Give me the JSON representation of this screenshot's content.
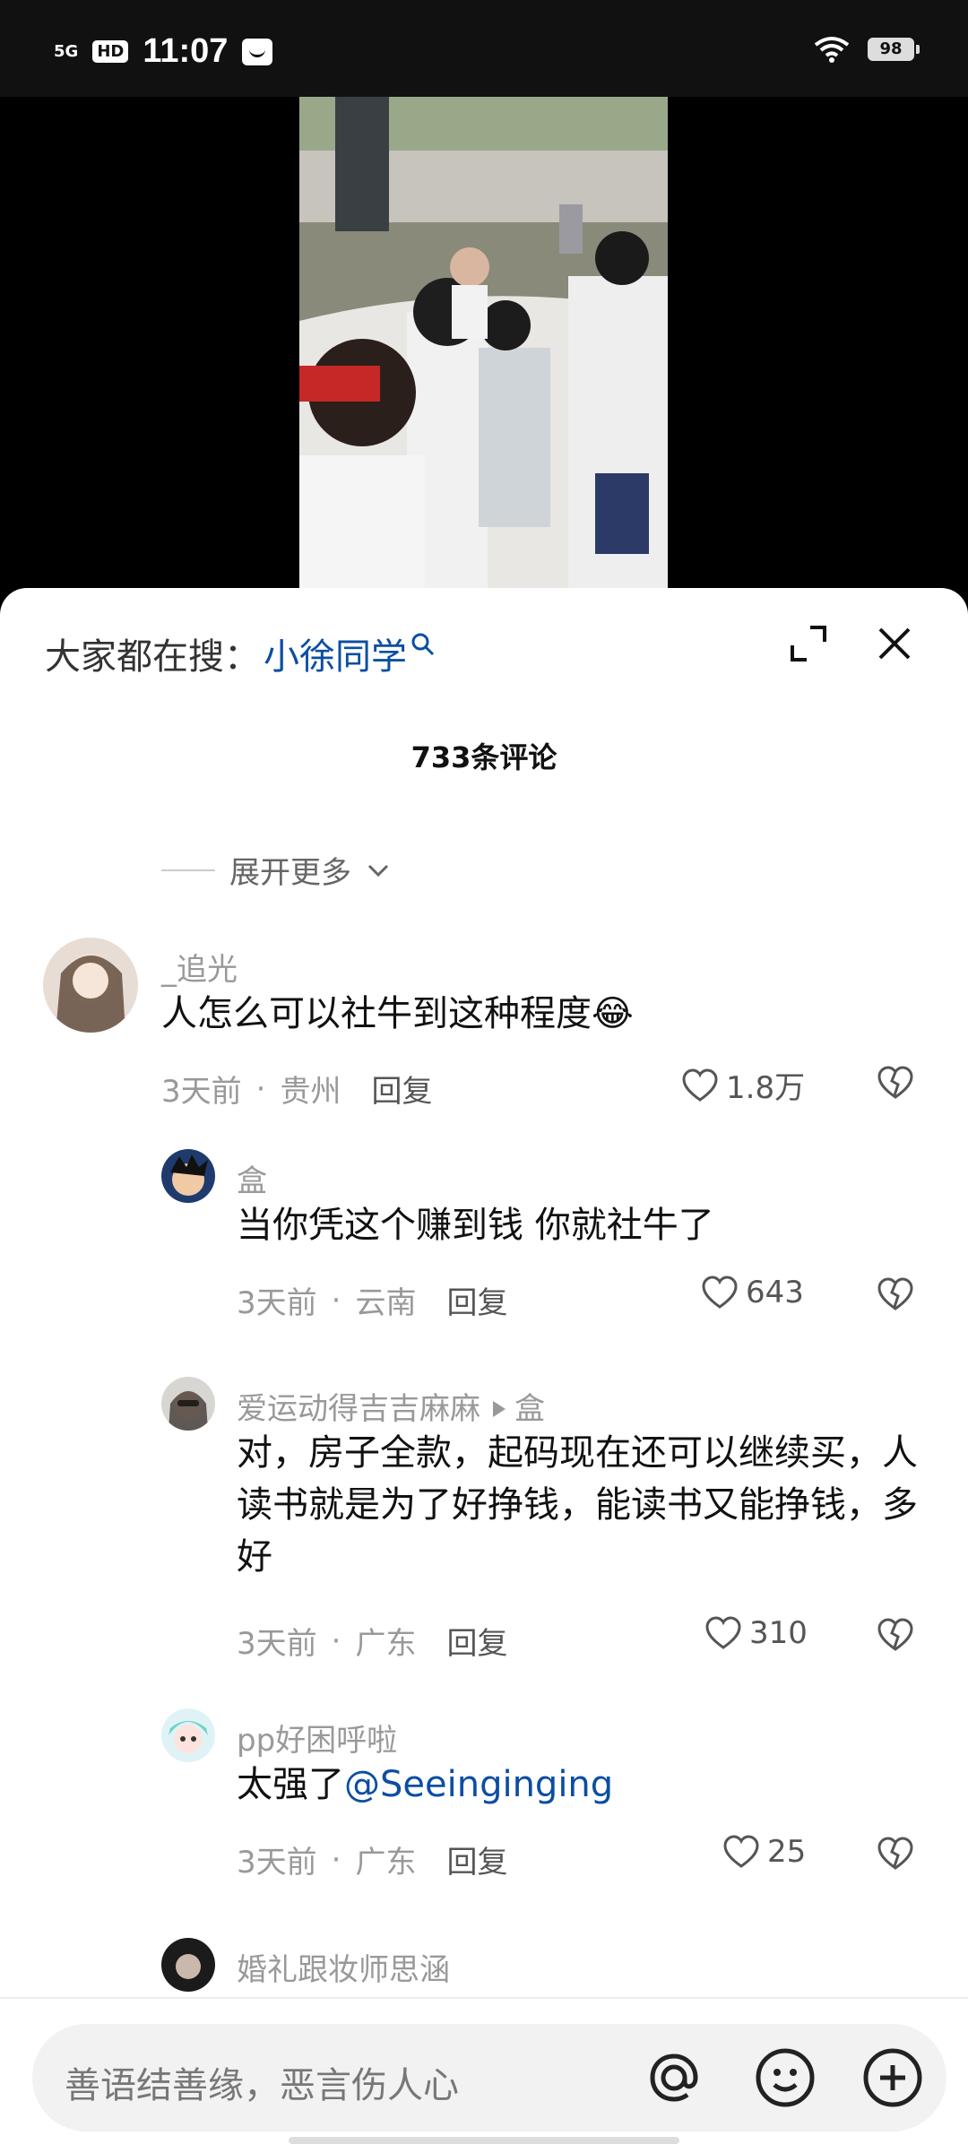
{
  "status_bar": {
    "signal": "5G",
    "hd": "HD",
    "time": "11:07",
    "battery": "98"
  },
  "sheet": {
    "search_prefix": "大家都在搜：",
    "search_term": "小徐同学",
    "comment_count": "733条评论",
    "expand_more": "展开更多"
  },
  "comments": [
    {
      "user": "_追光",
      "text": "人怎么可以社牛到这种程度😂",
      "time": "3天前",
      "location": "贵州",
      "reply": "回复",
      "likes": "1.8万"
    },
    {
      "user": "盒",
      "text": "当你凭这个赚到钱  你就社牛了",
      "time": "3天前",
      "location": "云南",
      "reply": "回复",
      "likes": "643"
    },
    {
      "user": "爱运动得吉吉麻麻",
      "reply_to": "盒",
      "text": "对，房子全款，起码现在还可以继续买，人读书就是为了好挣钱，能读书又能挣钱，多好",
      "time": "3天前",
      "location": "广东",
      "reply": "回复",
      "likes": "310"
    },
    {
      "user": "pp好困呼啦",
      "text_prefix": "太强了",
      "mention": "@Seeinginging",
      "time": "3天前",
      "location": "广东",
      "reply": "回复",
      "likes": "25"
    },
    {
      "user": "婚礼跟妆师思涵"
    }
  ],
  "input": {
    "placeholder": "善语结善缘，恶言伤人心"
  },
  "colors": {
    "accent_blue": "#0b4ea2",
    "meta_gray": "#999999"
  }
}
